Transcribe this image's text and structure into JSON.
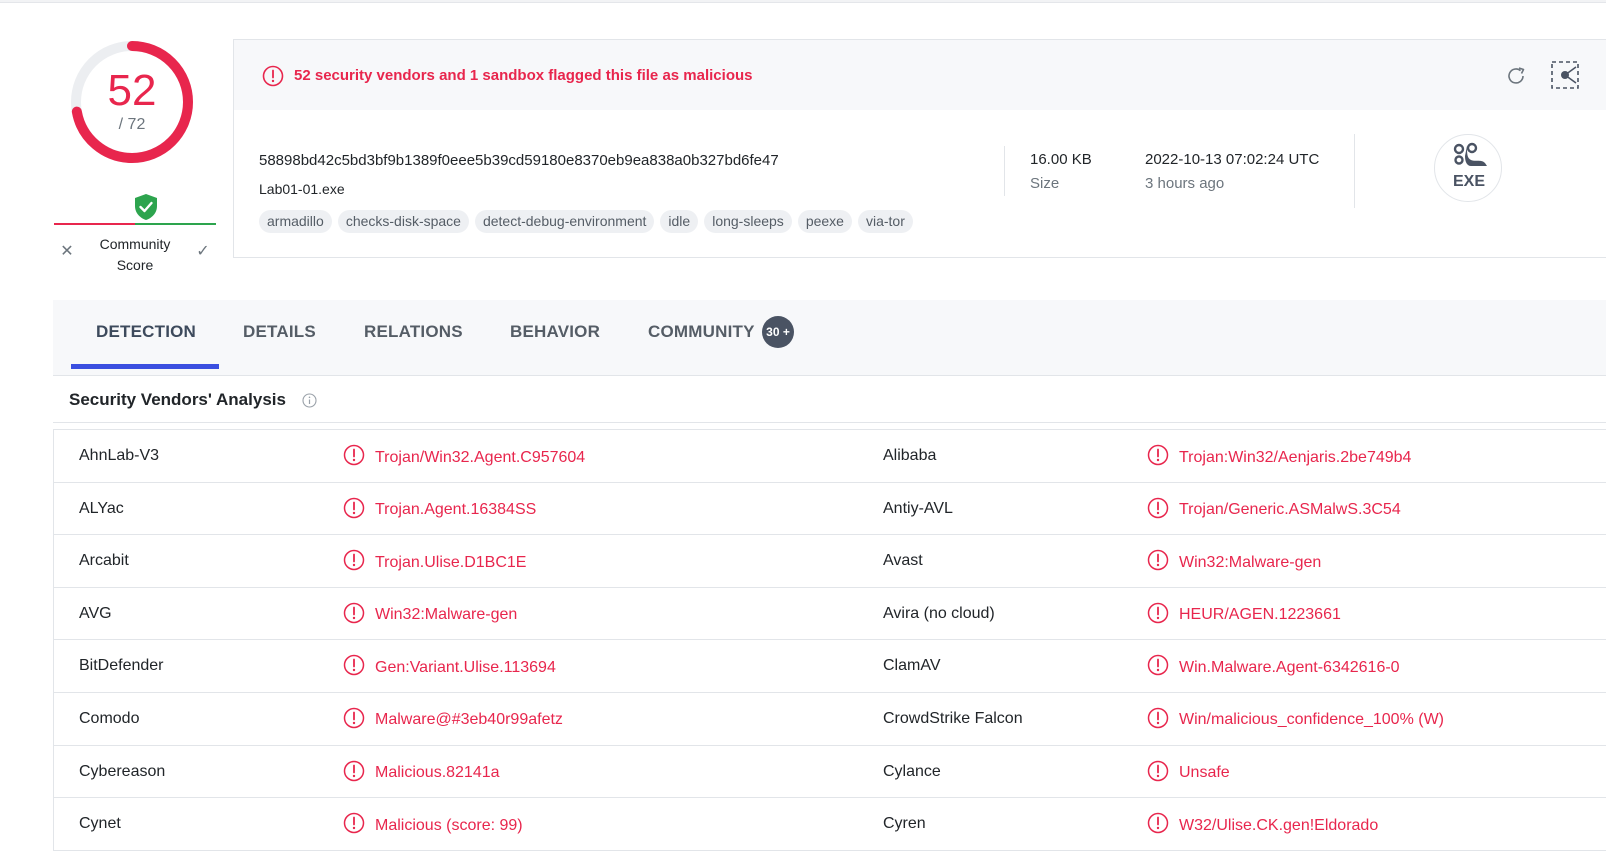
{
  "score": {
    "detections": "52",
    "total": "/ 72"
  },
  "community": {
    "label_line1": "Community",
    "label_line2": "Score"
  },
  "banner": {
    "text": "52 security vendors and 1 sandbox flagged this file as malicious"
  },
  "file": {
    "hash": "58898bd42c5bd3bf9b1389f0eee5b39cd59180e8370eb9ea838a0b327bd6fe47",
    "name": "Lab01-01.exe",
    "size_value": "16.00 KB",
    "size_label": "Size",
    "date_value": "2022-10-13 07:02:24 UTC",
    "date_label": "3 hours ago",
    "type_badge": "EXE"
  },
  "tags": [
    "armadillo",
    "checks-disk-space",
    "detect-debug-environment",
    "idle",
    "long-sleeps",
    "peexe",
    "via-tor"
  ],
  "tabs": {
    "detection": "DETECTION",
    "details": "DETAILS",
    "relations": "RELATIONS",
    "behavior": "BEHAVIOR",
    "community": "COMMUNITY",
    "community_badge": "30 +"
  },
  "section": {
    "title": "Security Vendors' Analysis"
  },
  "vendors": [
    {
      "left_name": "AhnLab-V3",
      "left_result": "Trojan/Win32.Agent.C957604",
      "right_name": "Alibaba",
      "right_result": "Trojan:Win32/Aenjaris.2be749b4"
    },
    {
      "left_name": "ALYac",
      "left_result": "Trojan.Agent.16384SS",
      "right_name": "Antiy-AVL",
      "right_result": "Trojan/Generic.ASMalwS.3C54"
    },
    {
      "left_name": "Arcabit",
      "left_result": "Trojan.Ulise.D1BC1E",
      "right_name": "Avast",
      "right_result": "Win32:Malware-gen"
    },
    {
      "left_name": "AVG",
      "left_result": "Win32:Malware-gen",
      "right_name": "Avira (no cloud)",
      "right_result": "HEUR/AGEN.1223661"
    },
    {
      "left_name": "BitDefender",
      "left_result": "Gen:Variant.Ulise.113694",
      "right_name": "ClamAV",
      "right_result": "Win.Malware.Agent-6342616-0"
    },
    {
      "left_name": "Comodo",
      "left_result": "Malware@#3eb40r99afetz",
      "right_name": "CrowdStrike Falcon",
      "right_result": "Win/malicious_confidence_100% (W)"
    },
    {
      "left_name": "Cybereason",
      "left_result": "Malicious.82141a",
      "right_name": "Cylance",
      "right_result": "Unsafe"
    },
    {
      "left_name": "Cynet",
      "left_result": "Malicious (score: 99)",
      "right_name": "Cyren",
      "right_result": "W32/Ulise.CK.gen!Eldorado"
    }
  ],
  "colors": {
    "malicious": "#e8264d",
    "harmless": "#2da44e",
    "tab_active": "#3b4fe0",
    "badge_bg": "#4a5363"
  },
  "icons": [
    "alert-circle-icon",
    "reload-icon",
    "graph-icon",
    "shield-check-icon",
    "close-icon",
    "check-icon",
    "info-icon",
    "exe-file-icon"
  ]
}
